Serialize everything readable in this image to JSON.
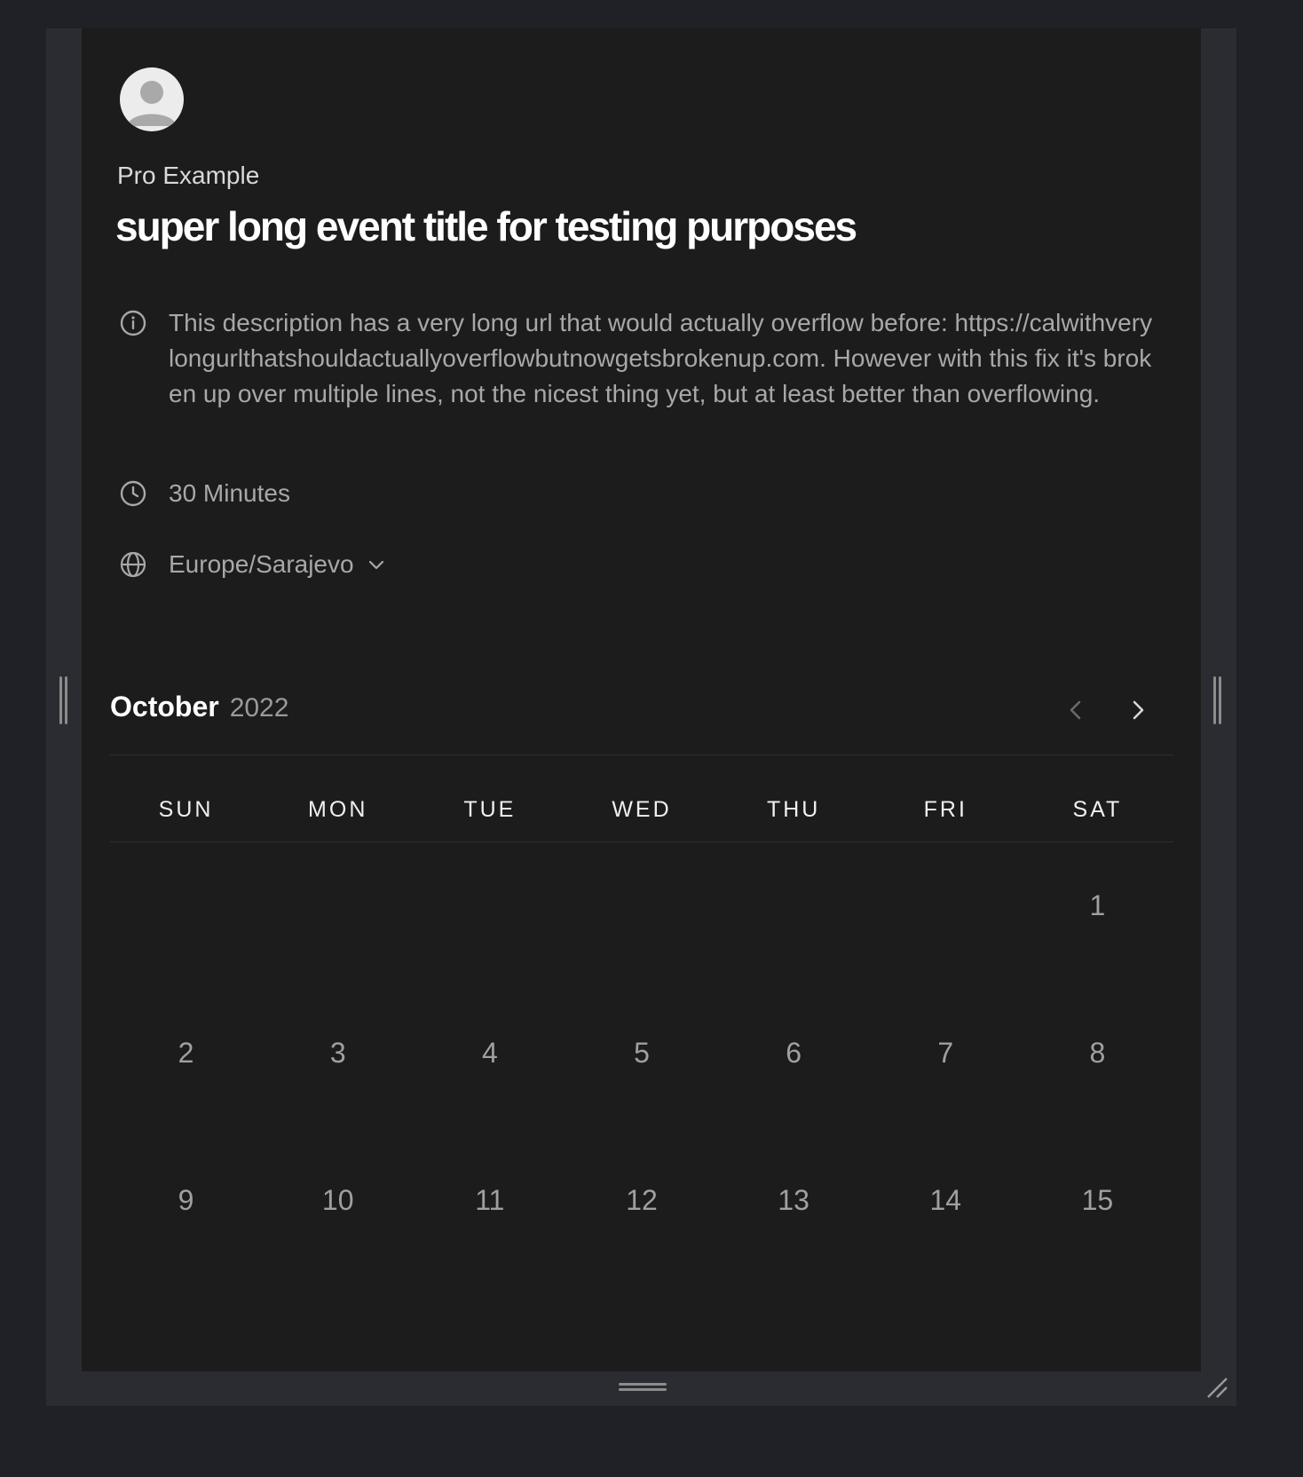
{
  "booking": {
    "organizer": "Pro Example",
    "title": "super long event title for testing purposes",
    "description": "This description has a very long url that would actually overflow before: https://calwithverylongurlthatshouldactuallyoverflowbutnowgetsbrokenup.com. However with this fix it's broken up over multiple lines, not the nicest thing yet, but at least better than overflowing.",
    "duration": "30 Minutes",
    "timezone": "Europe/Sarajevo"
  },
  "icons": {
    "info": "info-icon",
    "clock": "clock-icon",
    "globe": "globe-icon",
    "chevron_down": "chevron-down-icon",
    "prev": "chevron-left-icon",
    "next": "chevron-right-icon",
    "avatar": "user-avatar-icon"
  },
  "calendar": {
    "month": "October",
    "year": "2022",
    "weekdays": [
      "SUN",
      "MON",
      "TUE",
      "WED",
      "THU",
      "FRI",
      "SAT"
    ],
    "first_weekday_index": 6,
    "visible_days": [
      "1",
      "2",
      "3",
      "4",
      "5",
      "6",
      "7",
      "8",
      "9",
      "10",
      "11",
      "12",
      "13",
      "14",
      "15"
    ]
  },
  "colors": {
    "page_background": "#202126",
    "panel_background": "#1c1c1c",
    "title_text": "#ffffff",
    "muted_text": "#a8a8a8"
  }
}
